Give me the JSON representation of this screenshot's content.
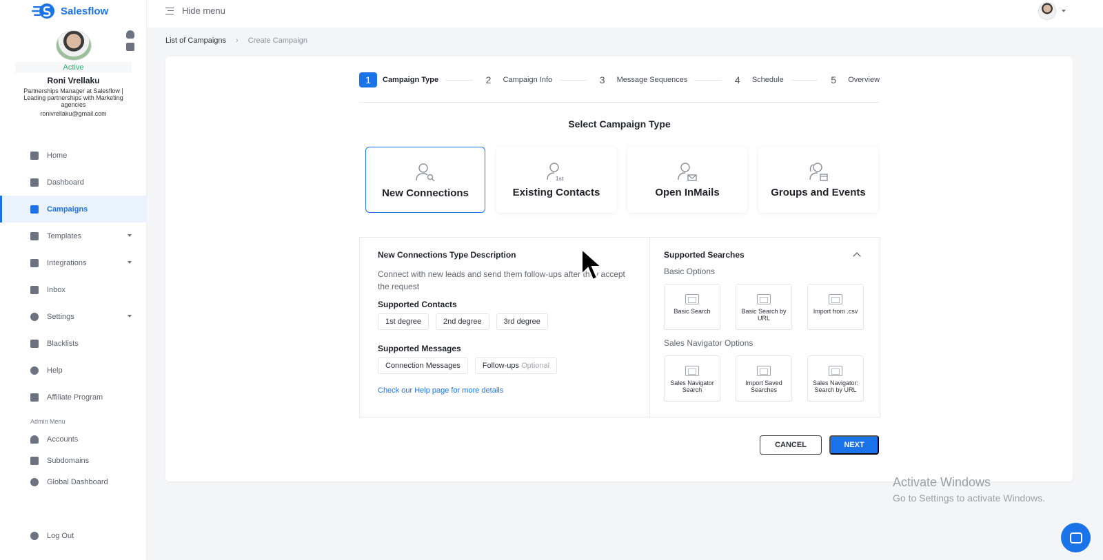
{
  "app": {
    "name": "Salesflow"
  },
  "topbar": {
    "hide_menu_label": "Hide menu"
  },
  "profile": {
    "status": "Active",
    "name": "Roni Vrellaku",
    "title": "Partnerships Manager at Salesflow | Leading partnerships with Marketing agencies",
    "email": "ronivrellaku@gmail.com"
  },
  "nav": {
    "items": [
      {
        "label": "Home",
        "icon": "home-icon"
      },
      {
        "label": "Dashboard",
        "icon": "bar-chart-icon"
      },
      {
        "label": "Campaigns",
        "icon": "grid-icon",
        "active": true
      },
      {
        "label": "Templates",
        "icon": "chat-icon",
        "dropdown": true
      },
      {
        "label": "Integrations",
        "icon": "integration-icon",
        "dropdown": true
      },
      {
        "label": "Inbox",
        "icon": "inbox-icon"
      },
      {
        "label": "Settings",
        "icon": "gear-icon",
        "dropdown": true
      },
      {
        "label": "Blacklists",
        "icon": "blacklist-icon"
      },
      {
        "label": "Help",
        "icon": "help-icon"
      },
      {
        "label": "Affiliate Program",
        "icon": "affiliate-icon"
      }
    ],
    "admin_label": "Admin Menu",
    "admin_items": [
      {
        "label": "Accounts",
        "icon": "user-icon"
      },
      {
        "label": "Subdomains",
        "icon": "building-icon"
      },
      {
        "label": "Global Dashboard",
        "icon": "globe-icon"
      }
    ],
    "logout_label": "Log Out"
  },
  "breadcrumb": {
    "parent": "List of Campaigns",
    "separator": "›",
    "current": "Create Campaign"
  },
  "stepper": [
    {
      "num": "1",
      "label": "Campaign Type",
      "active": true
    },
    {
      "num": "2",
      "label": "Campaign Info"
    },
    {
      "num": "3",
      "label": "Message Sequences"
    },
    {
      "num": "4",
      "label": "Schedule"
    },
    {
      "num": "5",
      "label": "Overview"
    }
  ],
  "select_title": "Select Campaign Type",
  "campaign_types": [
    {
      "label": "New Connections",
      "selected": true,
      "icon": "user-search-icon"
    },
    {
      "label": "Existing Contacts",
      "icon": "user-1st-icon"
    },
    {
      "label": "Open InMails",
      "icon": "user-mail-icon"
    },
    {
      "label": "Groups and Events",
      "icon": "group-event-icon"
    }
  ],
  "description": {
    "heading": "New Connections Type Description",
    "text": "Connect with new leads and send them follow-ups after they accept the request",
    "contacts_heading": "Supported Contacts",
    "contacts": [
      "1st degree",
      "2nd degree",
      "3rd degree"
    ],
    "messages_heading": "Supported Messages",
    "messages": [
      {
        "label": "Connection Messages",
        "optional": ""
      },
      {
        "label": "Follow-ups",
        "optional": "Optional"
      }
    ],
    "help_link": "Check our Help page for more details"
  },
  "searches": {
    "heading": "Supported Searches",
    "basic_label": "Basic Options",
    "basic": [
      "Basic Search",
      "Basic Search by URL",
      "Import from .csv"
    ],
    "nav_label": "Sales Navigator Options",
    "navigator": [
      "Sales Navigator Search",
      "Import Saved Searches",
      "Sales Navigator: Search by URL"
    ]
  },
  "actions": {
    "cancel": "CANCEL",
    "next": "NEXT"
  },
  "watermark": {
    "line1": "Activate Windows",
    "line2": "Go to Settings to activate Windows."
  },
  "colors": {
    "accent": "#1a73e8",
    "active_status": "#2faa6f"
  }
}
